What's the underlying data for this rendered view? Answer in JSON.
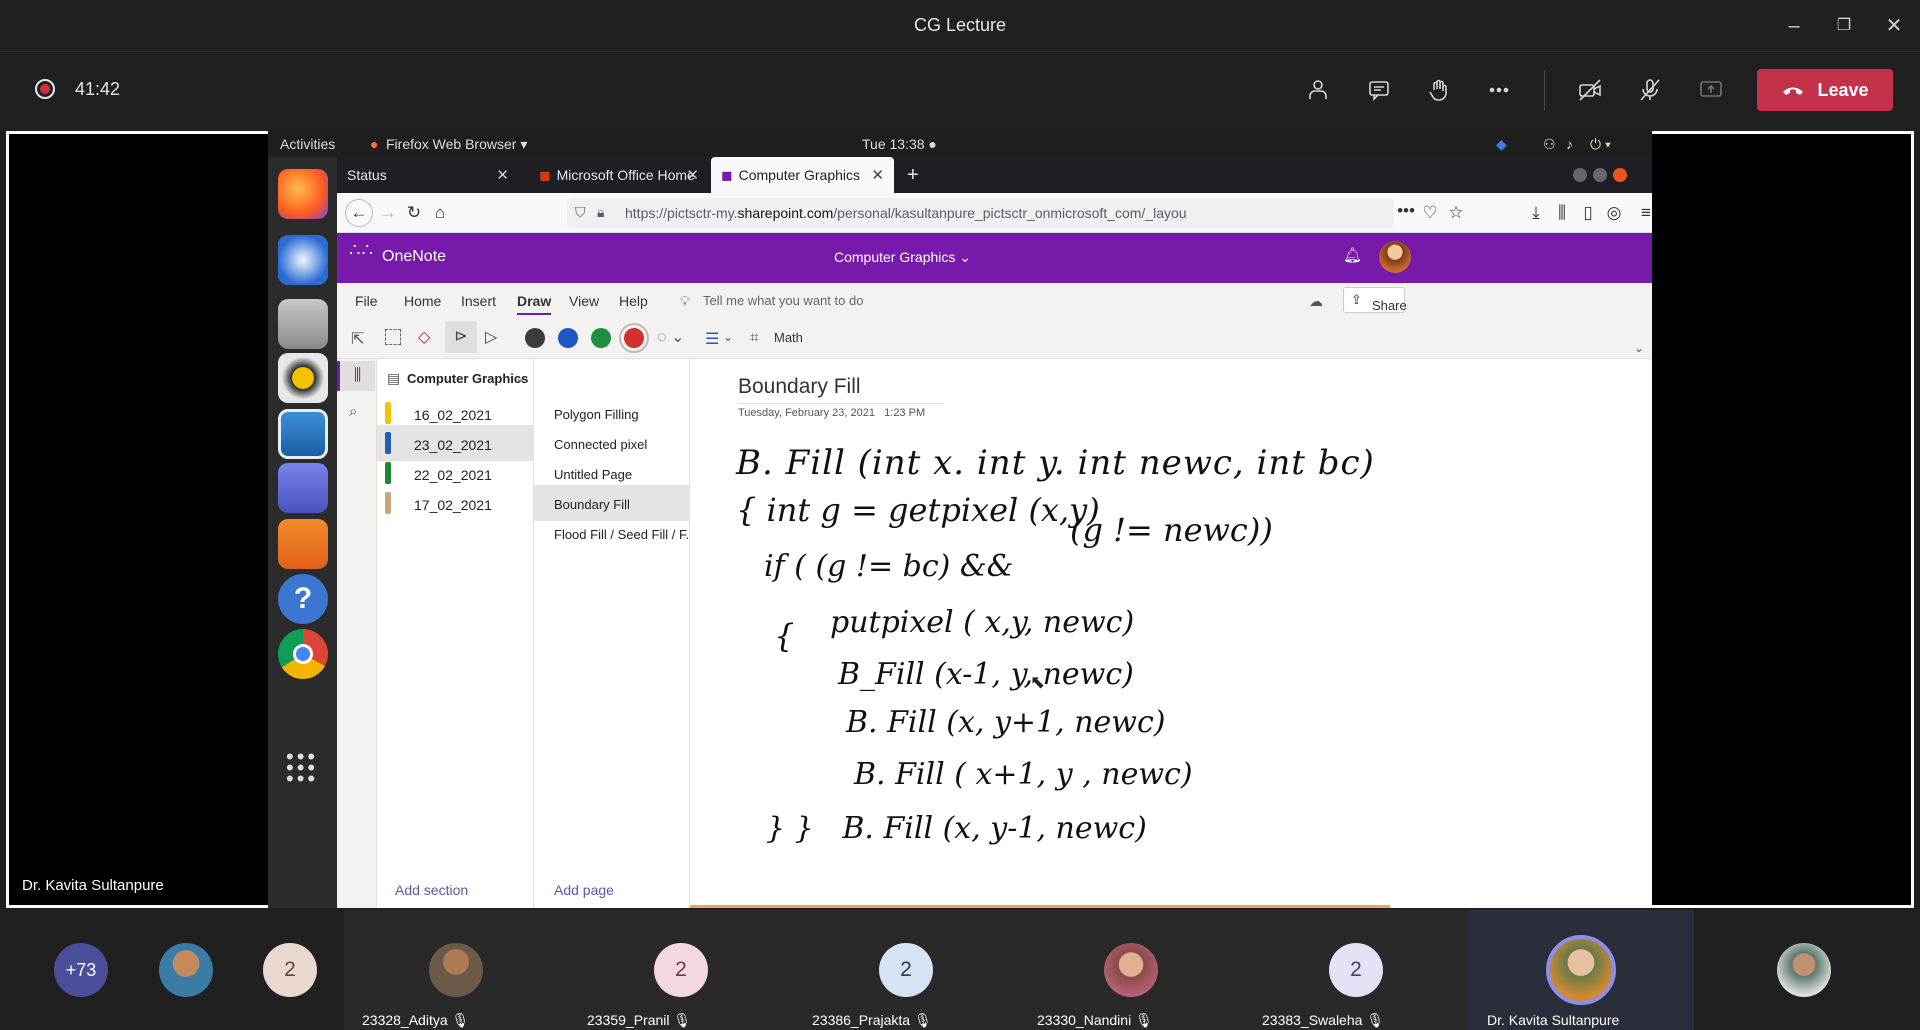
{
  "window": {
    "title": "CG Lecture"
  },
  "meeting": {
    "timer": "41:42",
    "leave_label": "Leave",
    "presenter_name": "Dr. Kavita Sultanpure",
    "buttons": [
      "people-icon",
      "chat-icon",
      "raise-hand-icon",
      "more-icon",
      "camera-off-icon",
      "mic-off-icon",
      "share-screen-icon"
    ]
  },
  "ubuntu": {
    "activities": "Activities",
    "app_menu": "Firefox Web Browser ▾",
    "clock": "Tue 13:38 ●"
  },
  "firefox": {
    "tabs": [
      {
        "label": "Status"
      },
      {
        "label": "Microsoft Office Home"
      },
      {
        "label": "Computer Graphics"
      }
    ],
    "url_prefix": "https://pictsctr-my.",
    "url_domain": "sharepoint.com",
    "url_rest": "/personal/kasultanpure_pictsctr_onmicrosoft_com/_layou",
    "url_more": "•••"
  },
  "onenote": {
    "app_name": "OneNote",
    "notebook_title": "Computer Graphics ⌄",
    "ribbon": {
      "file": "File",
      "home": "Home",
      "insert": "Insert",
      "draw": "Draw",
      "view": "View",
      "help": "Help",
      "tell_me": "Tell me what you want to do",
      "share": "Share"
    },
    "tools": {
      "math": "Math"
    },
    "pen_colors": [
      "#3c3c3c",
      "#1e56c4",
      "#1e8f3e",
      "#d32f2f"
    ],
    "notebook": "Computer Graphics",
    "sections": [
      {
        "label": "16_02_2021",
        "color": "#f2c300"
      },
      {
        "label": "23_02_2021",
        "color": "#1e5fb5"
      },
      {
        "label": "22_02_2021",
        "color": "#1a8a3a"
      },
      {
        "label": "17_02_2021",
        "color": "#c9a77c"
      }
    ],
    "pages": [
      {
        "label": "Polygon Filling"
      },
      {
        "label": "Connected pixel"
      },
      {
        "label": "Untitled Page"
      },
      {
        "label": "Boundary Fill"
      },
      {
        "label": "Flood Fill / Seed Fill / F..."
      }
    ],
    "add_section": "Add section",
    "add_page": "Add page",
    "page_title": "Boundary Fill",
    "page_date": "Tuesday, February 23, 2021",
    "page_time": "1:23 PM",
    "handwriting": [
      "B. Fill (int x. int y. int newc, int bc)",
      "{ int g = getpixel (x,y)",
      "(g != newc))",
      "if ( (g != bc) &&",
      "putpixel ( x,y, newc)",
      "{",
      "B_Fill (x-1, y, newc)",
      "B. Fill (x, y+1, newc)",
      "B. Fill ( x+1, y , newc)",
      "B. Fill (x, y-1, newc)",
      "}  }"
    ]
  },
  "participants": [
    {
      "name": "",
      "initials": "+73",
      "color": "#4b4e9b"
    },
    {
      "name": "",
      "initials": "",
      "color": "#3a7ca5"
    },
    {
      "name": "",
      "initials": "2",
      "color": "#e9d8cf"
    },
    {
      "name": "23328_Aditya",
      "initials": "",
      "color": "#6b5a4a"
    },
    {
      "name": "23359_Pranil",
      "initials": "2",
      "color": "#f3d8e2"
    },
    {
      "name": "23386_Prajakta",
      "initials": "2",
      "color": "#d6e3f5"
    },
    {
      "name": "23330_Nandini",
      "initials": "",
      "color": "#8a4a4a"
    },
    {
      "name": "23383_Swaleha",
      "initials": "2",
      "color": "#e6e1f5"
    },
    {
      "name": "Dr. Kavita Sultanpure",
      "initials": "",
      "color": "#6a7a4a"
    },
    {
      "name": "",
      "initials": "",
      "color": "#5a7a6a"
    }
  ]
}
